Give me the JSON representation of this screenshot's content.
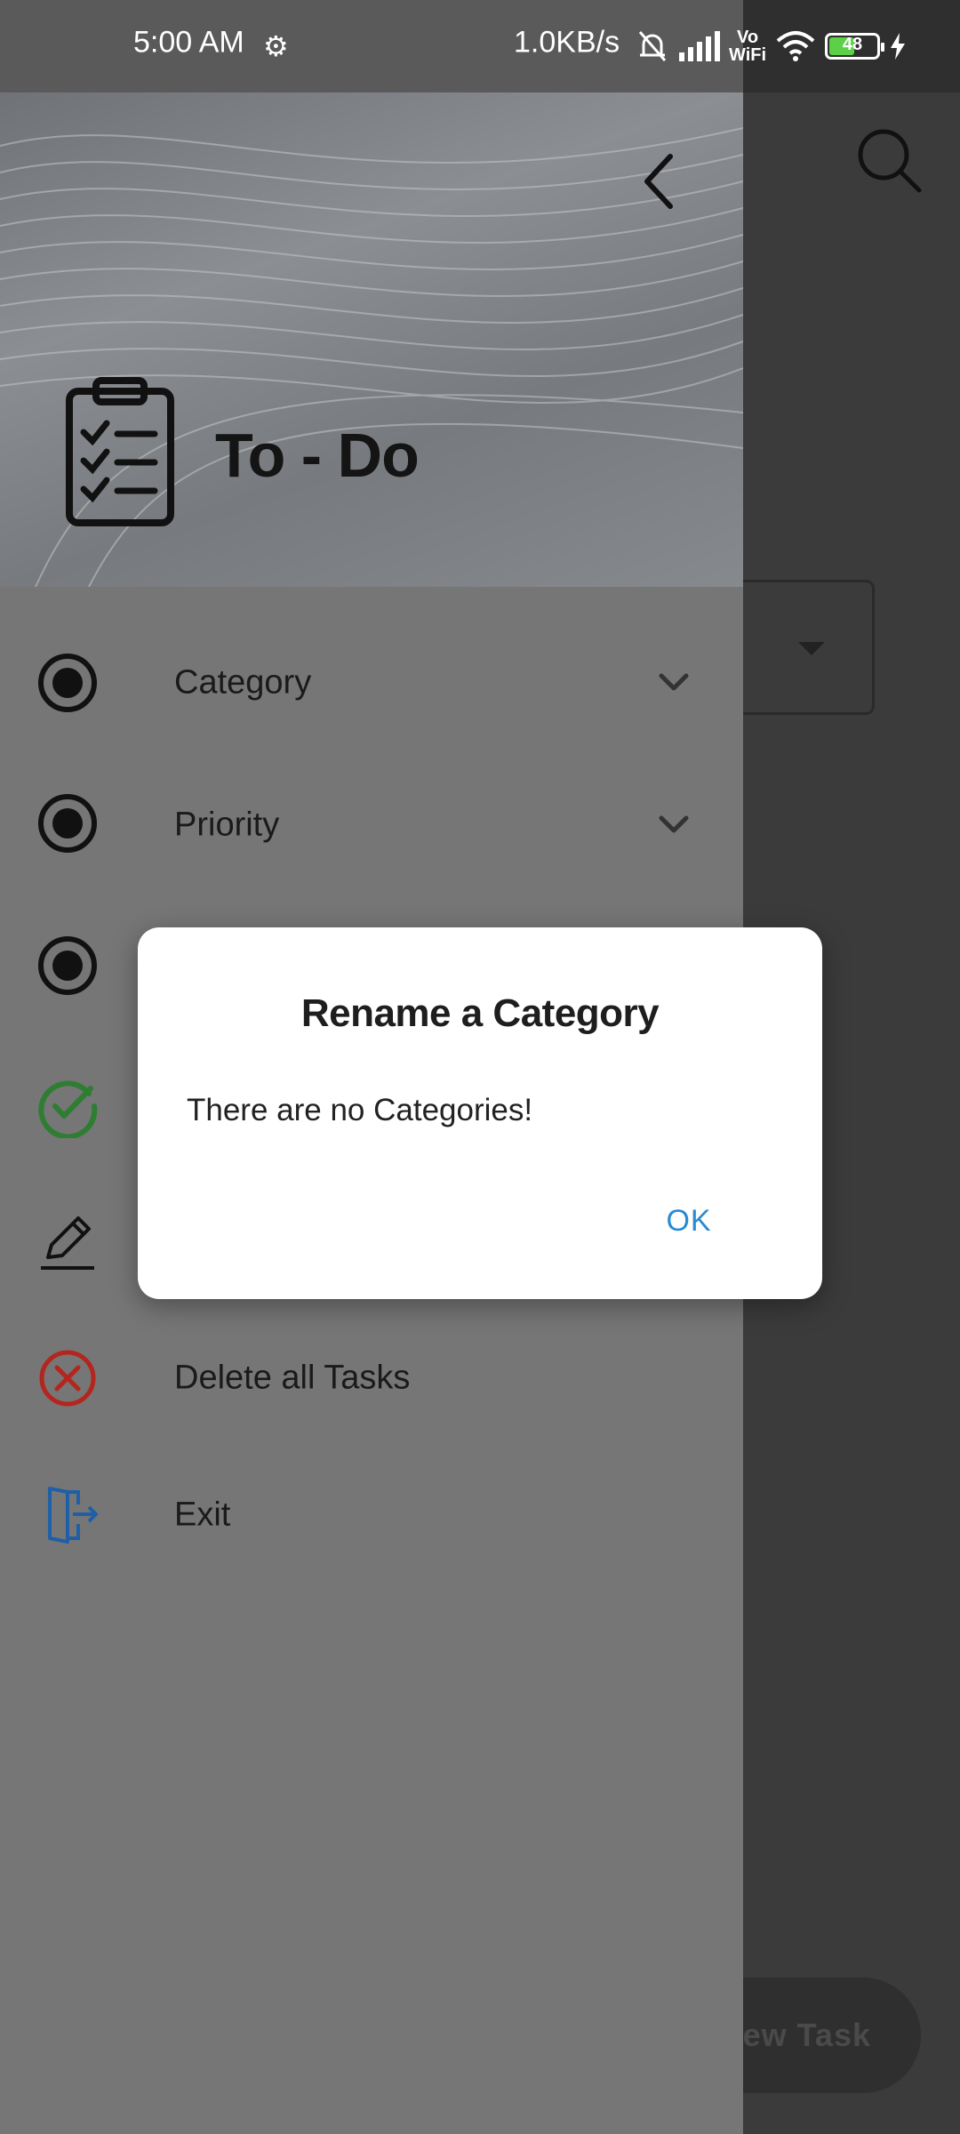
{
  "status_bar": {
    "time": "5:00 AM",
    "network_speed": "1.0KB/s",
    "volte_top": "Vo",
    "volte_bottom": "WiFi",
    "battery_level": "48",
    "icons": [
      "settings-gear-icon",
      "bell-muted-icon",
      "signal-icon",
      "wifi-icon",
      "battery-icon",
      "charging-bolt-icon"
    ]
  },
  "drawer": {
    "header": {
      "title": "To - Do",
      "logo_icon": "clipboard-checklist-icon",
      "back_icon": "chevron-left-icon"
    },
    "menu": [
      {
        "label": "Category",
        "icon": "radio-filled-icon",
        "expandable": true
      },
      {
        "label": "Priority",
        "icon": "radio-filled-icon",
        "expandable": true
      },
      {
        "label": "",
        "icon": "radio-filled-icon",
        "expandable": false
      },
      {
        "label": "",
        "icon": "check-circle-icon",
        "expandable": false
      },
      {
        "label": "",
        "icon": "pencil-icon",
        "expandable": false
      },
      {
        "label": "Delete all Tasks",
        "icon": "x-circle-icon",
        "expandable": false
      },
      {
        "label": "Exit",
        "icon": "exit-door-icon",
        "expandable": false
      }
    ]
  },
  "background_app": {
    "fab_label": "New Task",
    "search_icon": "search-icon"
  },
  "dialog": {
    "title": "Rename a Category",
    "message": "There are no Categories!",
    "ok_label": "OK"
  },
  "colors": {
    "accent_ok": "#2a8bd1",
    "check_green": "#2e7d32",
    "delete_red": "#b3261e",
    "exit_blue": "#1f5fa8"
  }
}
